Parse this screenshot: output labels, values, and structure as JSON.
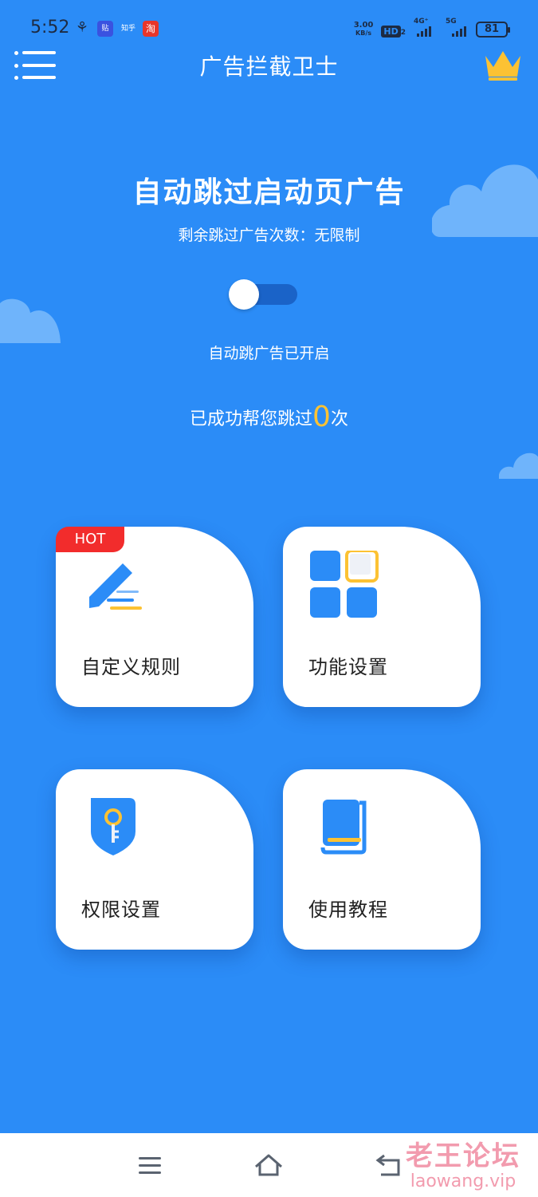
{
  "status_bar": {
    "time": "5:52",
    "apps": [
      "贴",
      "知乎",
      "淘"
    ],
    "net_speed": "3.00",
    "net_unit": "KB/s",
    "hd": "HD",
    "hd_sub": "2",
    "signal_1": "4G⁺",
    "signal_2": "5G",
    "battery": "81"
  },
  "app_bar": {
    "title": "广告拦截卫士",
    "menu_icon": "menu-icon",
    "crown_icon": "crown-icon",
    "crown_color": "#fcc233"
  },
  "hero": {
    "title": "自动跳过启动页广告",
    "subtitle": "剩余跳过广告次数：无限制",
    "toggle_on": true,
    "toggle_status": "自动跳广告已开启",
    "skip_prefix": "已成功帮您跳过",
    "skip_count": "0",
    "skip_suffix": "次"
  },
  "cards": [
    {
      "label": "自定义规则",
      "icon": "pen-icon",
      "badge": "HOT"
    },
    {
      "label": "功能设置",
      "icon": "grid-icon"
    },
    {
      "label": "权限设置",
      "icon": "key-shield-icon"
    },
    {
      "label": "使用教程",
      "icon": "book-icon"
    }
  ],
  "nav_bar": {
    "buttons": [
      "menu",
      "home",
      "back"
    ],
    "watermark_cn": "老王论坛",
    "watermark_url": "laowang.vip"
  },
  "colors": {
    "background": "#2b8cf7",
    "accent": "#fcc233",
    "hot": "#f22c2c",
    "icon_blue": "#2b8cf7"
  }
}
